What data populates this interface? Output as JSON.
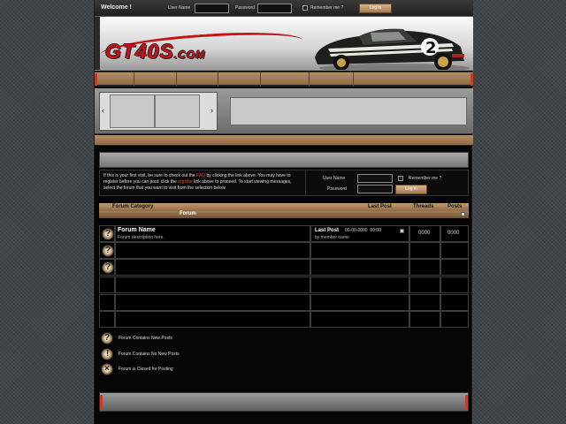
{
  "topbar": {
    "welcome": "Welcome !",
    "username_label": "User Name",
    "password_label": "Password",
    "remember_label": "Remember me ?",
    "login_button": "Log in"
  },
  "header": {
    "logo_main": "GT40S",
    "logo_suffix": ".COM",
    "car_number": "2"
  },
  "guest": {
    "message_before_faq": "If this is your first visit, be sure to check out the ",
    "faq_link": "FAQ",
    "message_mid": " by clicking the link above. You may have to register before you can post: click the ",
    "register_link": "register",
    "message_after": " link above to proceed. To start viewing messages, select the forum that you want to visit from the selection below.",
    "username_label": "User Name",
    "password_label": "Password",
    "remember_label": "Remember me ?",
    "login_button": "Log in"
  },
  "forum_table": {
    "columns": {
      "category": "Forum Category",
      "last_post": "Last Post",
      "threads": "Threads",
      "posts": "Posts"
    },
    "category_name": "Forum",
    "rows": [
      {
        "name": "Forum Name",
        "description": "Forum description here.",
        "last_post_label": "Last Post",
        "last_post_date": "00-00-0000",
        "last_post_time": "00:00",
        "last_post_by": "by member name",
        "threads": "0000",
        "posts": "0000"
      }
    ]
  },
  "legend": {
    "new_posts": "Forum Contains New Posts",
    "no_new_posts": "Forum Contains No New Posts",
    "closed": "Forum is Closed for Posting"
  },
  "colors": {
    "accent_tan": "#b58d63",
    "accent_red": "#e03214",
    "logo_red": "#c8101a"
  }
}
